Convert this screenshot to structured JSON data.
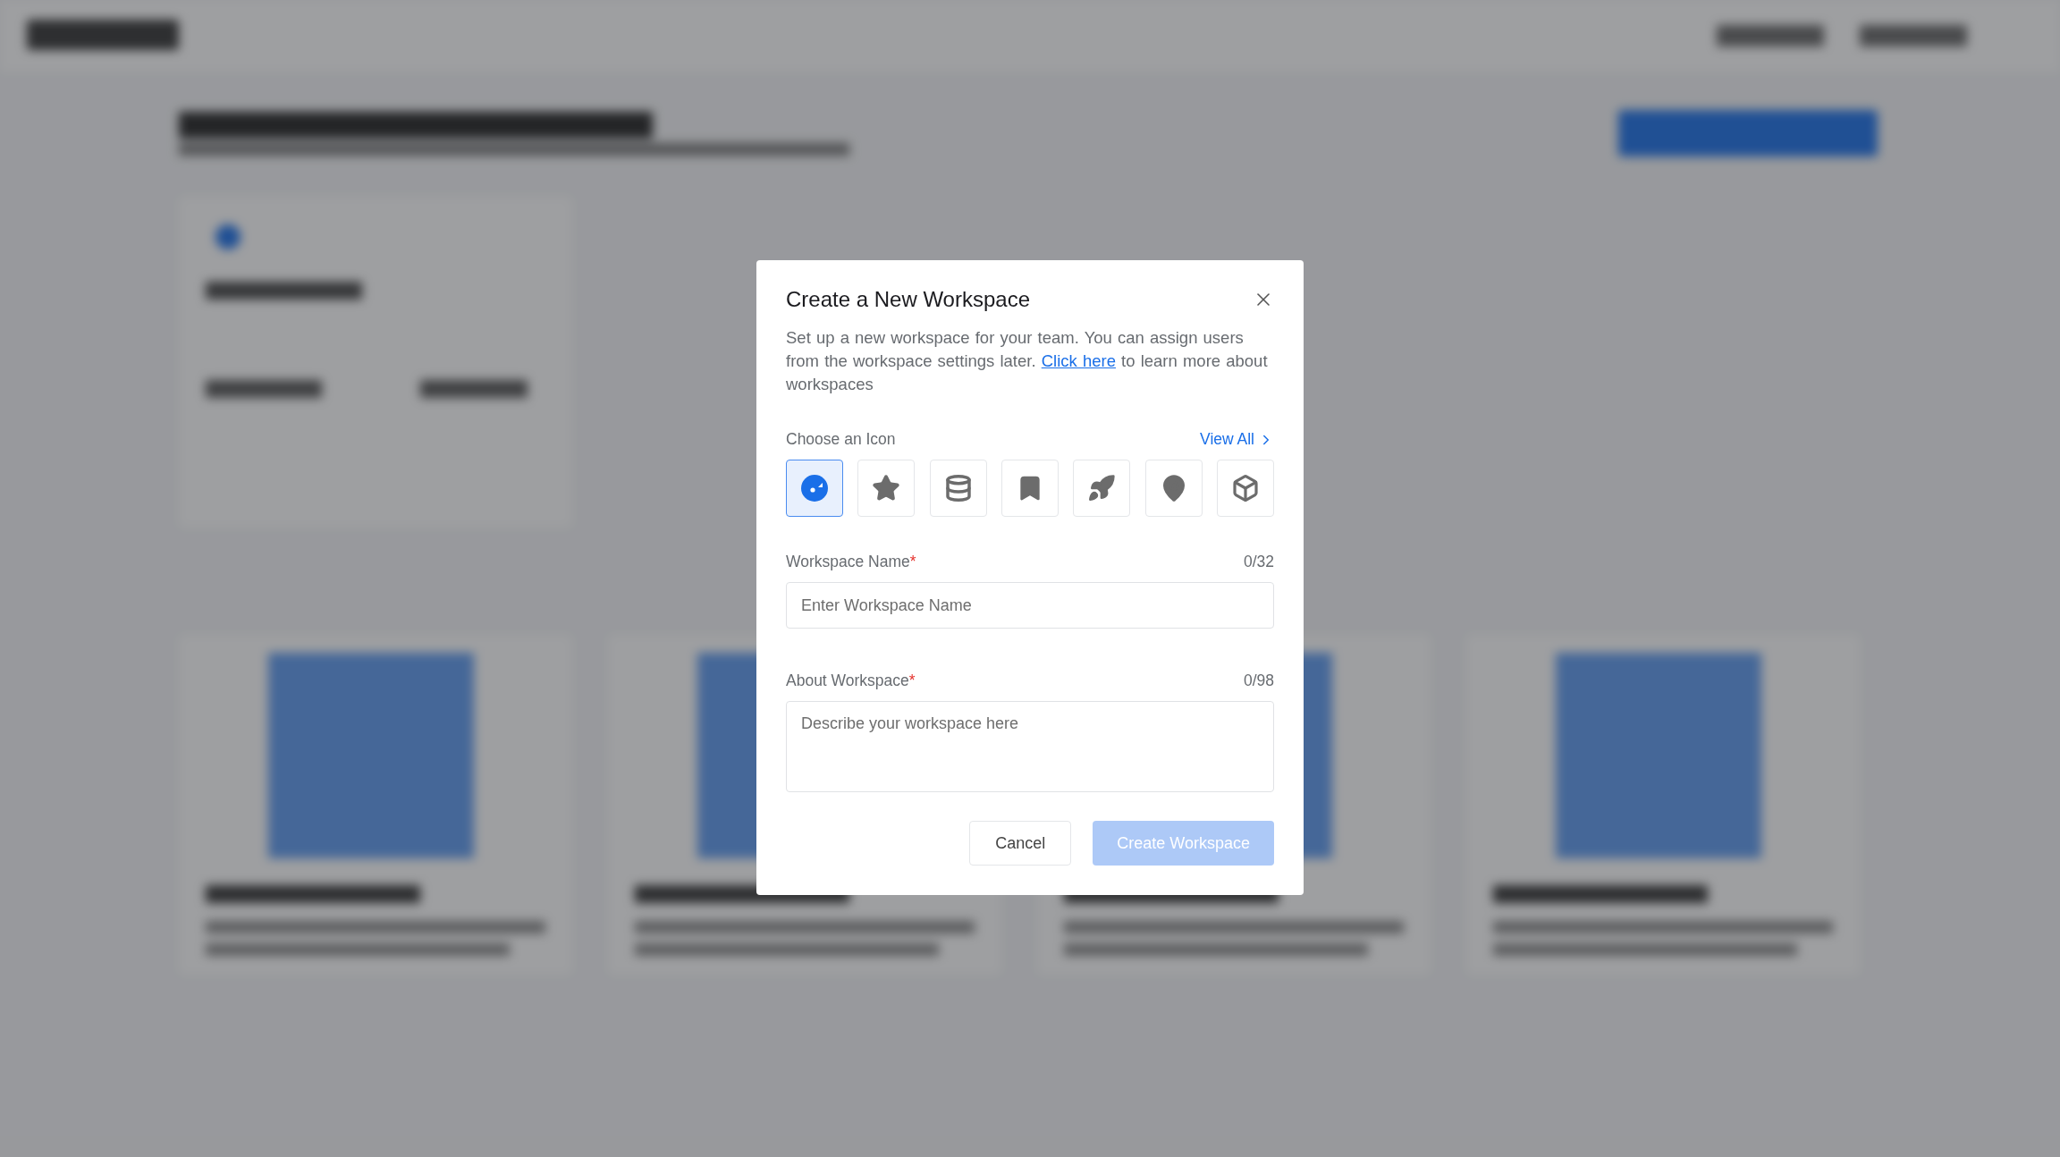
{
  "dialog": {
    "title": "Create a New Workspace",
    "description": {
      "before": "Set up a new workspace for your team. You can assign users from the workspace settings later. ",
      "link": "Click here",
      "after": " to learn more about workspaces"
    },
    "icon_picker": {
      "label": "Choose an Icon",
      "view_all": "View All",
      "icons": [
        {
          "kind": "disc",
          "selected": true
        },
        {
          "kind": "star",
          "selected": false
        },
        {
          "kind": "database",
          "selected": false
        },
        {
          "kind": "bookmark",
          "selected": false
        },
        {
          "kind": "rocket",
          "selected": false
        },
        {
          "kind": "pin",
          "selected": false
        },
        {
          "kind": "cube",
          "selected": false
        }
      ]
    },
    "fields": [
      {
        "kind": "input",
        "label": "Workspace Name",
        "required_mark": "*",
        "counter": "0/32",
        "placeholder": "Enter Workspace Name"
      },
      {
        "kind": "textarea",
        "label": "About Workspace",
        "required_mark": "*",
        "counter": "0/98",
        "placeholder": "Describe your workspace here"
      }
    ],
    "buttons": [
      {
        "kind": "secondary",
        "label": "Cancel"
      },
      {
        "kind": "primary",
        "label": "Create Workspace",
        "disabled": true
      }
    ]
  }
}
